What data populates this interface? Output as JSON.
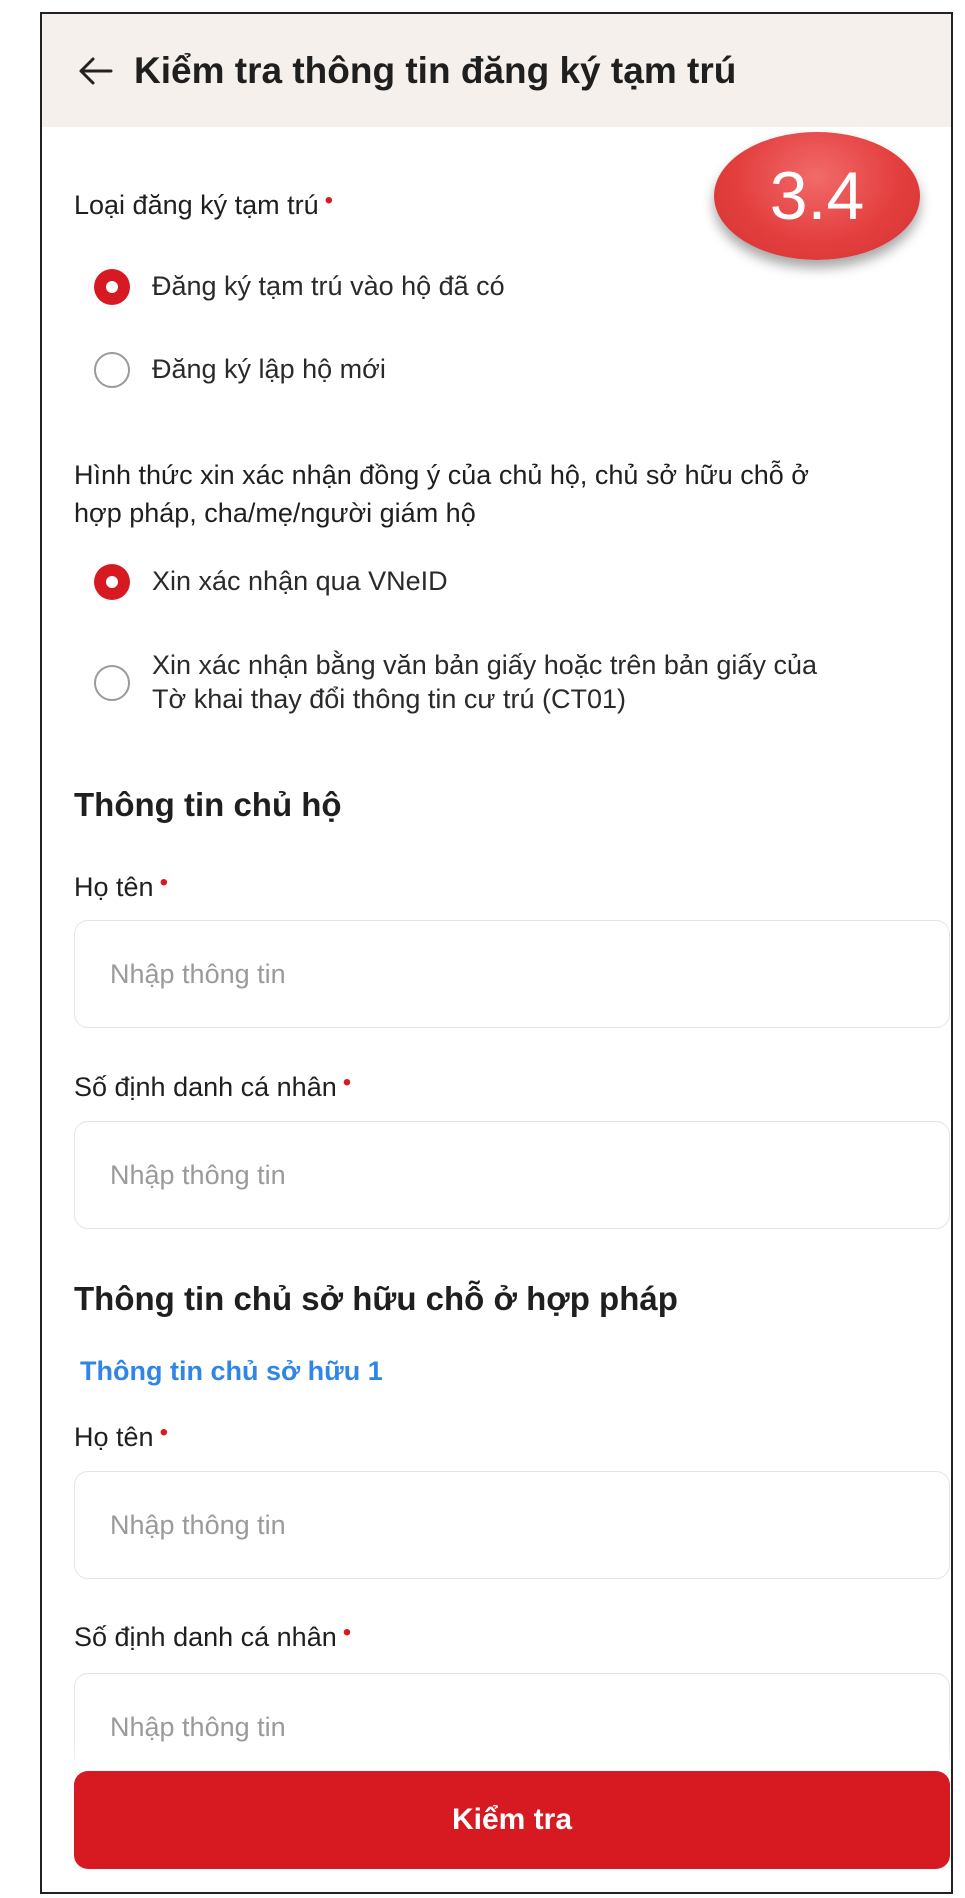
{
  "header": {
    "title": "Kiểm tra thông tin đăng ký tạm trú",
    "back_icon": "arrow-left-icon"
  },
  "badge": {
    "text": "3.4",
    "color": "#e43f3f"
  },
  "registration_type": {
    "label": "Loại đăng ký tạm trú",
    "required_mark": "•",
    "options": [
      {
        "label": "Đăng ký tạm trú vào hộ đã có",
        "selected": true
      },
      {
        "label": "Đăng ký lập hộ mới",
        "selected": false
      }
    ]
  },
  "consent_method": {
    "label_line1": "Hình thức xin xác nhận đồng ý của chủ hộ, chủ sở hữu chỗ ở",
    "label_line2": "hợp pháp, cha/mẹ/người giám hộ",
    "options": [
      {
        "label": "Xin xác nhận qua VNeID",
        "selected": true
      },
      {
        "label_line1": "Xin xác nhận bằng văn bản giấy hoặc trên bản giấy của",
        "label_line2": "Tờ khai thay đổi thông tin cư trú (CT01)",
        "selected": false
      }
    ]
  },
  "household_head": {
    "title": "Thông tin chủ hộ",
    "name_label": "Họ tên",
    "name_placeholder": "Nhập thông tin",
    "id_label": "Số định danh cá nhân",
    "id_placeholder": "Nhập thông tin"
  },
  "legal_owner": {
    "title": "Thông tin chủ sở hữu chỗ ở hợp pháp",
    "owner_subtitle": "Thông tin chủ sở hữu 1",
    "name_label": "Họ tên",
    "name_placeholder": "Nhập thông tin",
    "id_label": "Số định danh cá nhân",
    "id_placeholder": "Nhập thông tin"
  },
  "submit_label": "Kiểm tra",
  "colors": {
    "primary": "#d71a21",
    "link": "#2f86e8",
    "header_bg": "#f5f0ec"
  }
}
